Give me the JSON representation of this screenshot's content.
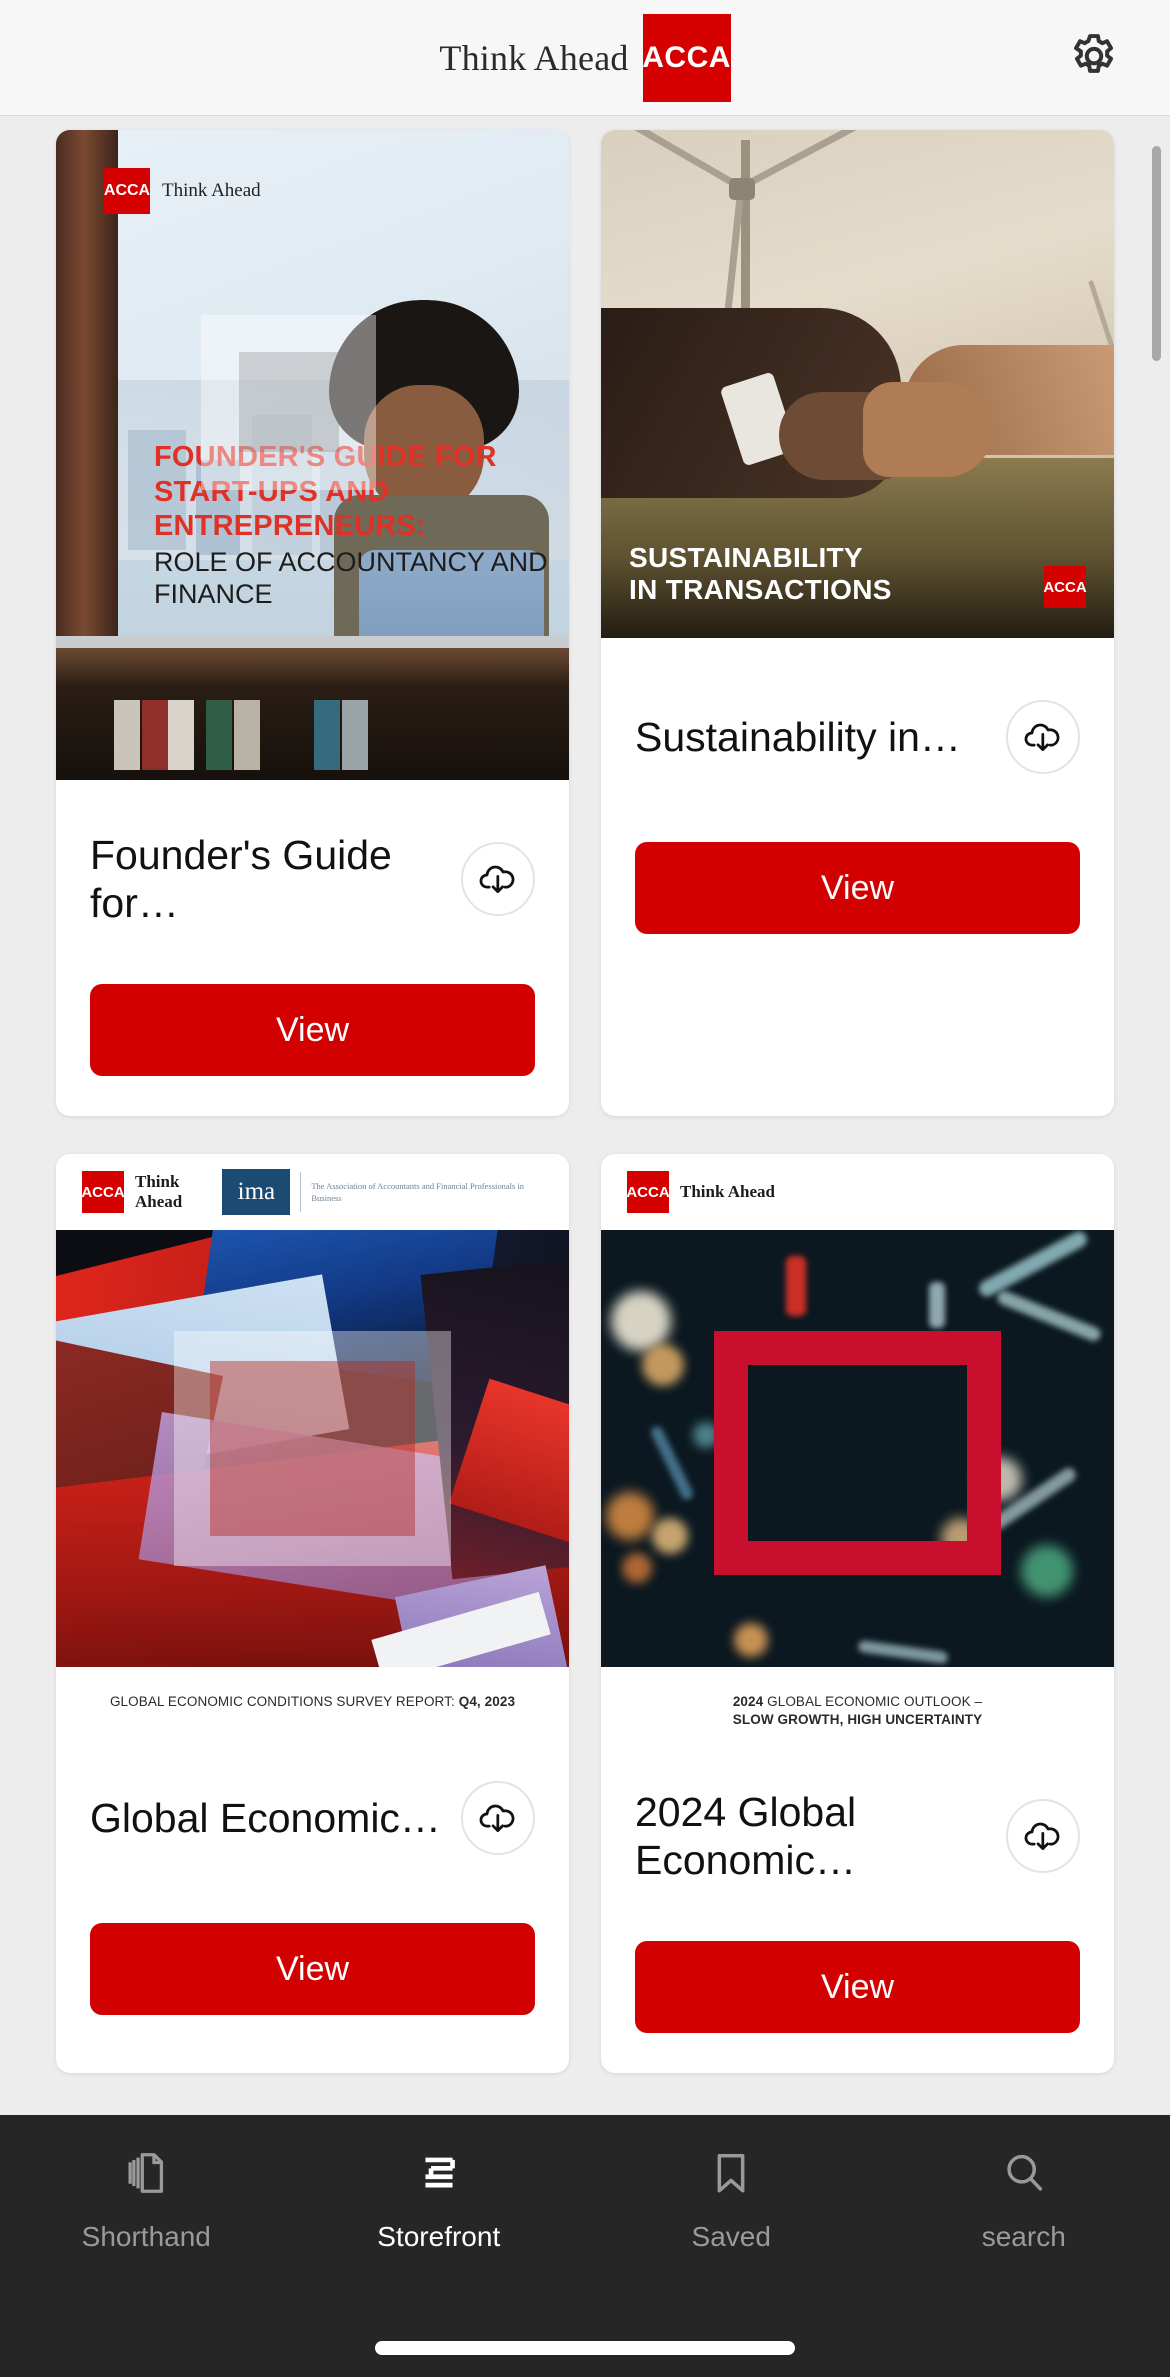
{
  "header": {
    "brand_tagline": "Think Ahead",
    "brand_logo_text": "ACCA",
    "settings_icon": "gear-icon"
  },
  "cards": [
    {
      "title": "Founder's Guide for…",
      "view_label": "View",
      "download_icon": "cloud-download-icon",
      "cover": {
        "type": "founders-guide",
        "logo_text": "ACCA",
        "logo_tagline": "Think Ahead",
        "headline": "FOUNDER'S GUIDE FOR START-UPS AND ENTREPRENEURS:",
        "subhead": "ROLE OF ACCOUNTANCY AND FINANCE"
      }
    },
    {
      "title": "Sustainability in…",
      "view_label": "View",
      "download_icon": "cloud-download-icon",
      "cover": {
        "type": "sustainability",
        "headline_line1": "SUSTAINABILITY",
        "headline_line2": "IN TRANSACTIONS",
        "logo_text": "ACCA"
      }
    },
    {
      "title": "Global Economic…",
      "view_label": "View",
      "download_icon": "cloud-download-icon",
      "cover": {
        "type": "gecs-abstract",
        "logo_text": "ACCA",
        "logo_tagline": "Think Ahead",
        "partner_logo_text": "ima",
        "partner_tagline": "The Association of Accountants and Financial Professionals in Business",
        "caption_plain": "GLOBAL ECONOMIC CONDITIONS SURVEY REPORT: ",
        "caption_bold": "Q4, 2023"
      }
    },
    {
      "title": "2024 Global Economic…",
      "view_label": "View",
      "download_icon": "cloud-download-icon",
      "cover": {
        "type": "outlook-bokeh",
        "logo_text": "ACCA",
        "logo_tagline": "Think Ahead",
        "caption_bold_lead": "2024",
        "caption_plain": " GLOBAL ECONOMIC OUTLOOK –",
        "caption_bold": "SLOW GROWTH, HIGH UNCERTAINTY"
      }
    }
  ],
  "tabbar": {
    "items": [
      {
        "label": "Shorthand",
        "icon": "documents-stack-icon",
        "active": false
      },
      {
        "label": "Storefront",
        "icon": "storefront-lines-icon",
        "active": true
      },
      {
        "label": "Saved",
        "icon": "bookmark-icon",
        "active": false
      },
      {
        "label": "search",
        "icon": "search-icon",
        "active": false
      }
    ]
  },
  "colors": {
    "brand_red": "#d50000",
    "button_red": "#d20000",
    "tabbar_bg": "#262626",
    "page_bg": "#ededed"
  }
}
